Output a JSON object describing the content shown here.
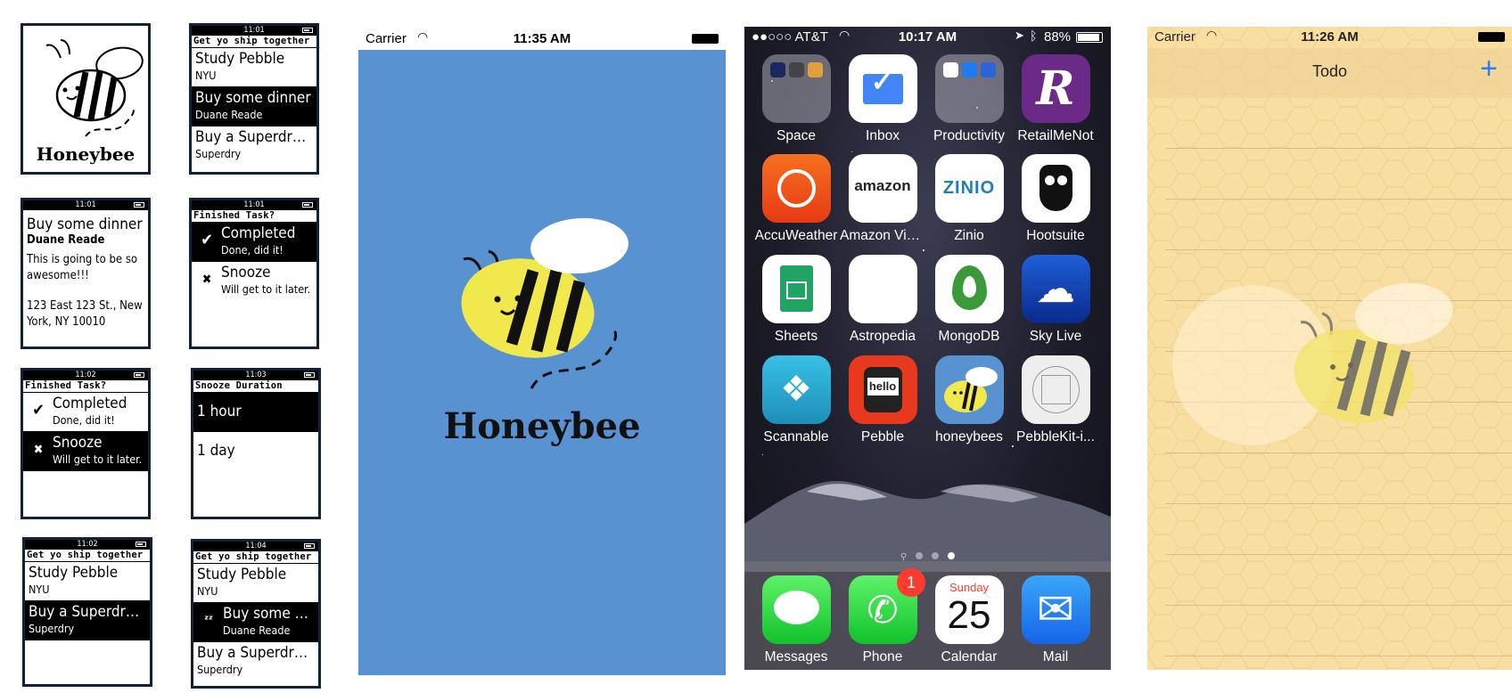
{
  "pebble": {
    "logo": {
      "title": "Honeybee"
    },
    "screen_list1": {
      "time": "11:01",
      "header": "Get yo ship together",
      "items": [
        {
          "title": "Study Pebble",
          "sub": "NYU",
          "selected": false
        },
        {
          "title": "Buy some dinner",
          "sub": "Duane Reade",
          "selected": true
        },
        {
          "title": "Buy a Superdry j...",
          "sub": "Superdry",
          "selected": false
        }
      ]
    },
    "screen_detail": {
      "time": "11:01",
      "title": "Buy some dinner",
      "subtitle": "Duane Reade",
      "body": "This is going to be so awesome!!!",
      "address": "123 East 123 St., New York, NY 10010"
    },
    "screen_finished1": {
      "time": "11:01",
      "header": "Finished Task?",
      "items": [
        {
          "title": "Completed",
          "sub": "Done, did it!",
          "icon": "check-icon",
          "glyph": "✔",
          "selected": true
        },
        {
          "title": "Snooze",
          "sub": "Will get to it later.",
          "icon": "x-icon",
          "glyph": "✖",
          "selected": false
        }
      ]
    },
    "screen_finished2": {
      "time": "11:02",
      "header": "Finished Task?",
      "items": [
        {
          "title": "Completed",
          "sub": "Done, did it!",
          "icon": "check-icon",
          "glyph": "✔",
          "selected": false
        },
        {
          "title": "Snooze",
          "sub": "Will get to it later.",
          "icon": "x-icon",
          "glyph": "✖",
          "selected": true
        }
      ]
    },
    "screen_snooze": {
      "time": "11:03",
      "header": "Snooze Duration",
      "items": [
        {
          "title": "1 hour",
          "selected": true
        },
        {
          "title": "1 day",
          "selected": false
        }
      ]
    },
    "screen_list2": {
      "time": "11:02",
      "header": "Get yo ship together",
      "items": [
        {
          "title": "Study Pebble",
          "sub": "NYU",
          "selected": false
        },
        {
          "title": "Buy a Superdry j...",
          "sub": "Superdry",
          "selected": true
        }
      ]
    },
    "screen_list3": {
      "time": "11:04",
      "header": "Get yo ship together",
      "items": [
        {
          "title": "Study Pebble",
          "sub": "NYU",
          "selected": false
        },
        {
          "title": "Buy some di...",
          "sub": "Duane Reade",
          "selected": true,
          "glyph": "ᶻᶻ"
        },
        {
          "title": "Buy a Superdry j...",
          "sub": "Superdry",
          "selected": false
        }
      ]
    }
  },
  "splash": {
    "carrier": "Carrier",
    "time": "11:35 AM",
    "title": "Honeybee",
    "bg": "#5992d0"
  },
  "home": {
    "carrier": "●●○○○ AT&T",
    "time": "10:17 AM",
    "battery": "88%",
    "apps": [
      {
        "label": "Space"
      },
      {
        "label": "Inbox"
      },
      {
        "label": "Productivity"
      },
      {
        "label": "RetailMeNot"
      },
      {
        "label": "AccuWeather"
      },
      {
        "label": "Amazon Video"
      },
      {
        "label": "Zinio"
      },
      {
        "label": "Hootsuite"
      },
      {
        "label": "Sheets"
      },
      {
        "label": "Astropedia"
      },
      {
        "label": "MongoDB"
      },
      {
        "label": "Sky Live"
      },
      {
        "label": "Scannable"
      },
      {
        "label": "Pebble"
      },
      {
        "label": "honeybees"
      },
      {
        "label": "PebbleKit-i..."
      }
    ],
    "icon_text": {
      "amazon": "amazon",
      "zinio": "ZINIO",
      "pebble": "hello",
      "retail": "R"
    },
    "dock": [
      {
        "label": "Messages"
      },
      {
        "label": "Phone",
        "badge": "1"
      },
      {
        "label": "Calendar",
        "day": "Sunday",
        "date": "25"
      },
      {
        "label": "Mail"
      }
    ]
  },
  "todo": {
    "carrier": "Carrier",
    "time": "11:26 AM",
    "title": "Todo",
    "add": "+"
  }
}
